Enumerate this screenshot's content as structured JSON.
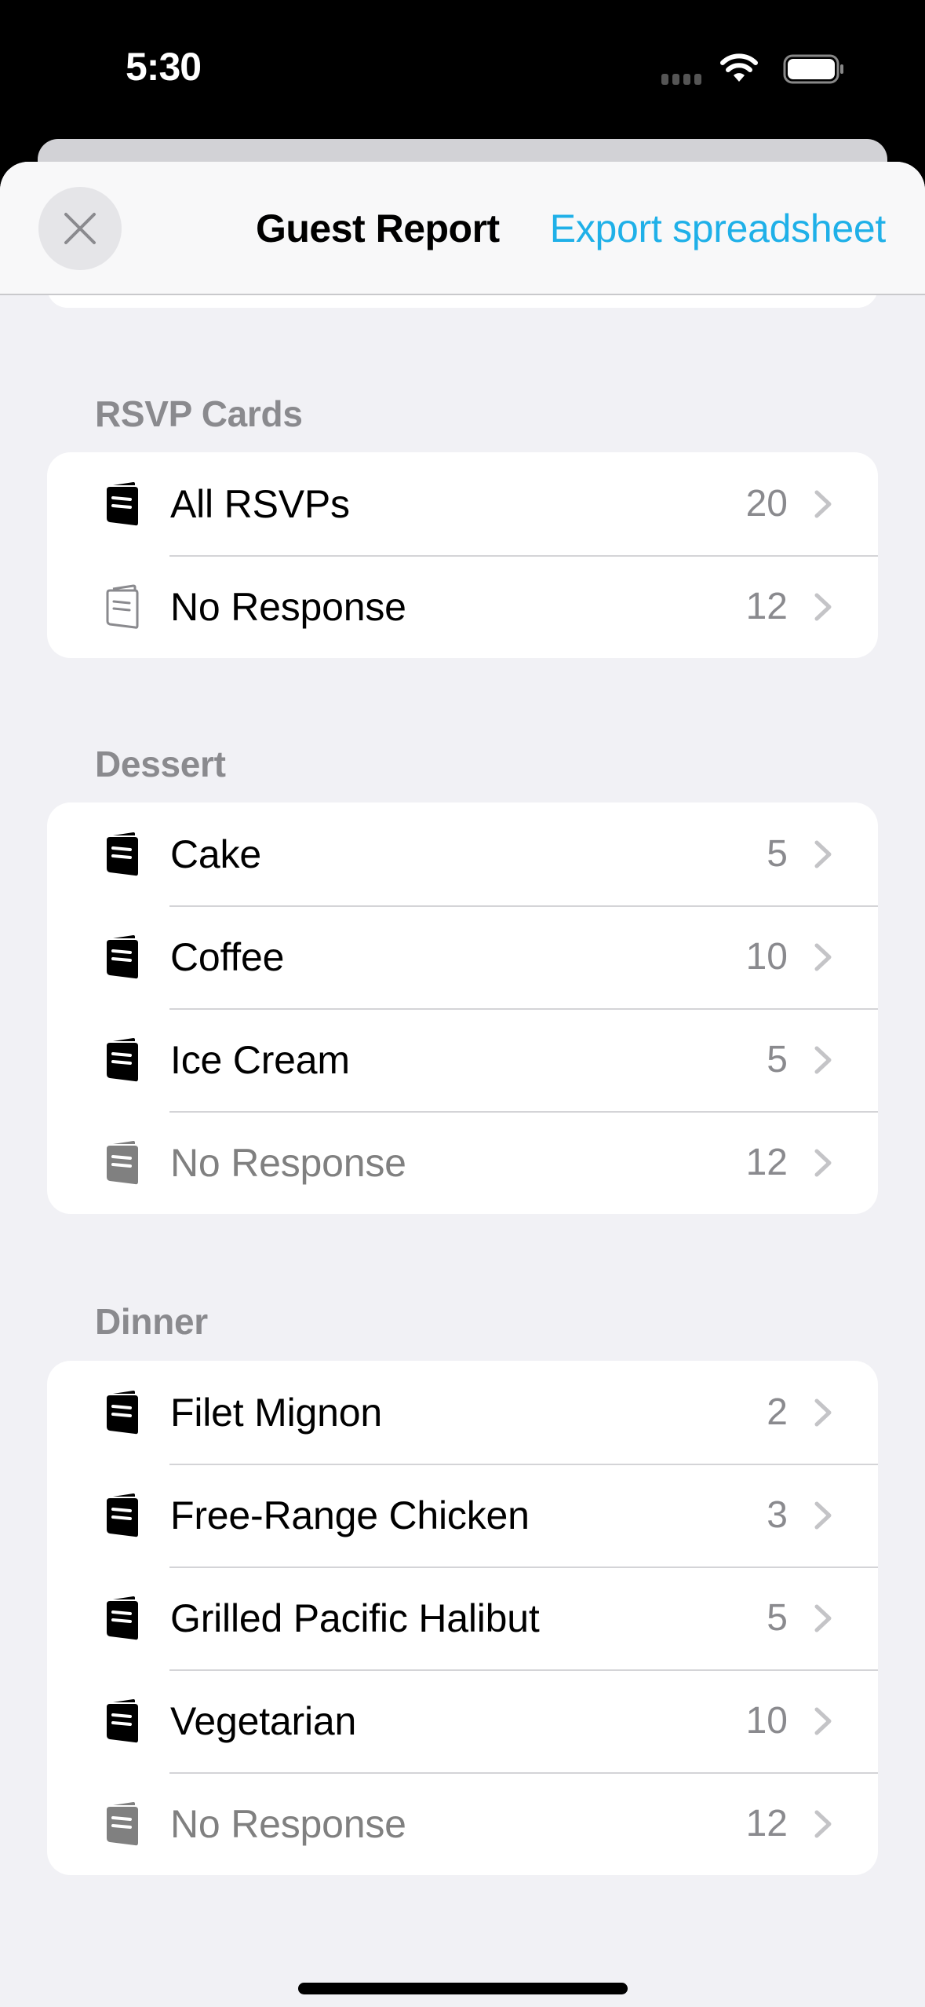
{
  "status_bar": {
    "time": "5:30",
    "icons": [
      "signal-dots-icon",
      "wifi-icon",
      "battery-icon"
    ]
  },
  "nav": {
    "title": "Guest Report",
    "close_icon": "close-icon",
    "export_label": "Export spreadsheet",
    "accent_color": "#1fb0e8"
  },
  "sections": [
    {
      "title": "RSVP Cards",
      "rows": [
        {
          "label": "All RSVPs",
          "count": "20",
          "icon": "card-filled-icon",
          "muted": false
        },
        {
          "label": "No Response",
          "count": "12",
          "icon": "card-outline-icon",
          "muted": false
        }
      ]
    },
    {
      "title": "Dessert",
      "rows": [
        {
          "label": "Cake",
          "count": "5",
          "icon": "card-filled-icon",
          "muted": false
        },
        {
          "label": "Coffee",
          "count": "10",
          "icon": "card-filled-icon",
          "muted": false
        },
        {
          "label": "Ice Cream",
          "count": "5",
          "icon": "card-filled-icon",
          "muted": false
        },
        {
          "label": "No Response",
          "count": "12",
          "icon": "card-filled-gray-icon",
          "muted": true
        }
      ]
    },
    {
      "title": "Dinner",
      "rows": [
        {
          "label": "Filet Mignon",
          "count": "2",
          "icon": "card-filled-icon",
          "muted": false
        },
        {
          "label": "Free-Range Chicken",
          "count": "3",
          "icon": "card-filled-icon",
          "muted": false
        },
        {
          "label": "Grilled Pacific Halibut",
          "count": "5",
          "icon": "card-filled-icon",
          "muted": false
        },
        {
          "label": "Vegetarian",
          "count": "10",
          "icon": "card-filled-icon",
          "muted": false
        },
        {
          "label": "No Response",
          "count": "12",
          "icon": "card-filled-gray-icon",
          "muted": true
        }
      ]
    }
  ]
}
